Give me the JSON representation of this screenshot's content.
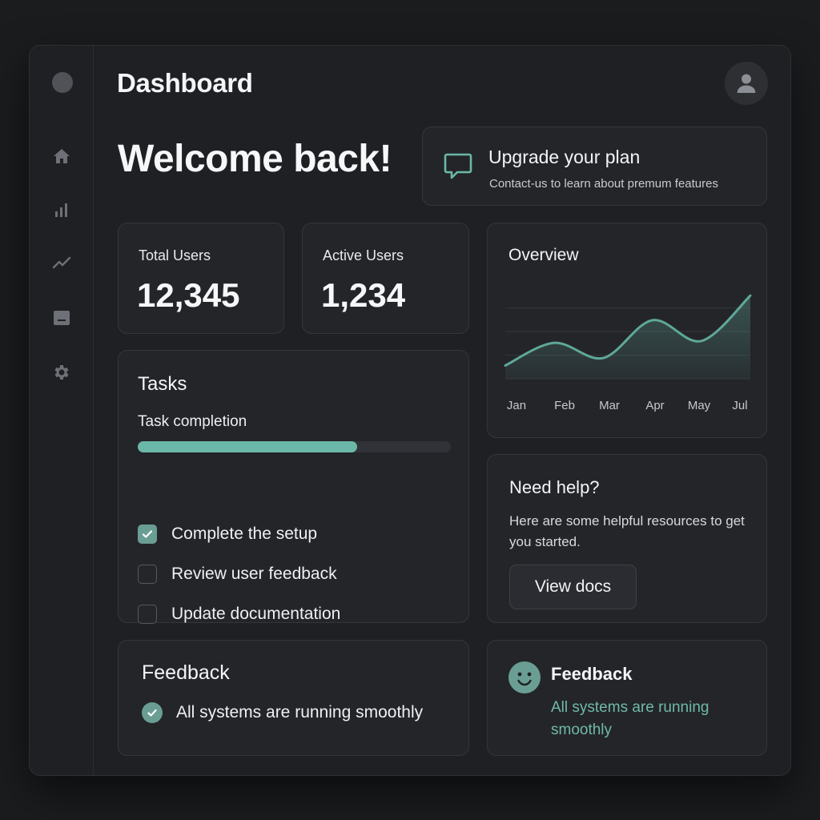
{
  "header": {
    "title": "Dashboard"
  },
  "sidebar": {
    "items": [
      {
        "icon": "home-icon"
      },
      {
        "icon": "bar-chart-icon"
      },
      {
        "icon": "trend-line-icon"
      },
      {
        "icon": "inbox-icon"
      },
      {
        "icon": "gear-icon"
      }
    ]
  },
  "welcome": "Welcome back!",
  "upgrade": {
    "title": "Upgrade your plan",
    "subtitle": "Contact-us to learn about premum features",
    "icon": "chat-bubble-icon"
  },
  "stats": [
    {
      "label": "Total Users",
      "value": "12,345"
    },
    {
      "label": "Active Users",
      "value": "1,234"
    }
  ],
  "overview": {
    "title": "Overview",
    "chart_data": {
      "type": "area",
      "categories": [
        "Jan",
        "Feb",
        "Mar",
        "Apr",
        "May",
        "Jul"
      ],
      "values": [
        14,
        38,
        22,
        62,
        40,
        88
      ],
      "ylim": [
        0,
        100
      ],
      "grid": true,
      "color": "#5fa899"
    }
  },
  "tasks": {
    "title": "Tasks",
    "progress_label": "Task completion",
    "progress": 0.7,
    "items": [
      {
        "label": "Complete the setup",
        "checked": true
      },
      {
        "label": "Review user feedback",
        "checked": false
      },
      {
        "label": "Update documentation",
        "checked": false
      }
    ]
  },
  "help": {
    "title": "Need help?",
    "body": "Here are some helpful resources to get you started.",
    "button": "View docs"
  },
  "feedback_status": {
    "title": "Feedback",
    "text": "All systems are running smoothly"
  },
  "feedback_card": {
    "title": "Feedback",
    "text": "All systems are running smoothly",
    "icon": "smiley-icon"
  },
  "colors": {
    "accent": "#6bb8a8",
    "background": "#1b1c1e",
    "card": "#242529"
  }
}
